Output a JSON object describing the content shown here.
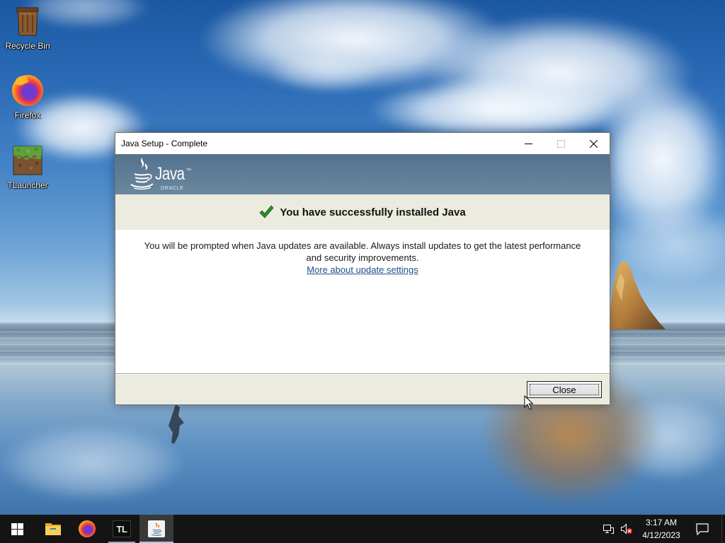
{
  "desktop": {
    "icons": [
      {
        "label": "Recycle Bin",
        "icon": "recycle-bin-icon"
      },
      {
        "label": "Firefox",
        "icon": "firefox-icon"
      },
      {
        "label": "TLauncher",
        "icon": "tlauncher-icon"
      }
    ]
  },
  "dialog": {
    "title": "Java Setup - Complete",
    "title_controls": [
      "minimize-icon",
      "maximize-icon",
      "close-icon"
    ],
    "banner": {
      "icon": "java-cup-icon",
      "logo_text": "Java",
      "trademark": "™",
      "vendor": "ORACLE"
    },
    "status": {
      "icon": "checkmark-icon",
      "message": "You have successfully installed Java"
    },
    "body_lines": [
      "You will be prompted when Java updates are available. Always install updates to get the latest performance",
      "and security improvements."
    ],
    "link_text": "More about update settings",
    "close_button_label": "Close"
  },
  "taskbar": {
    "start_icon": "windows-start-icon",
    "apps": [
      {
        "icon": "file-explorer-icon",
        "running": false,
        "active": false
      },
      {
        "icon": "firefox-icon",
        "running": false,
        "active": false
      },
      {
        "icon": "tlauncher-icon",
        "label": "TL",
        "running": true,
        "active": false
      },
      {
        "icon": "java-setup-icon",
        "running": true,
        "active": true
      }
    ],
    "tray_icons": [
      "network-icon",
      "volume-muted-icon",
      "notification-icon"
    ],
    "clock": {
      "time": "3:17 AM",
      "date": "4/12/2023"
    }
  },
  "colors": {
    "banner": "#6a889f",
    "status_bg": "#ecebdf",
    "link": "#22508f",
    "success_check": "#2f8a2f",
    "taskbar": "#141414",
    "active_app": "#393939",
    "active_indicator": "#a9c3e2"
  }
}
